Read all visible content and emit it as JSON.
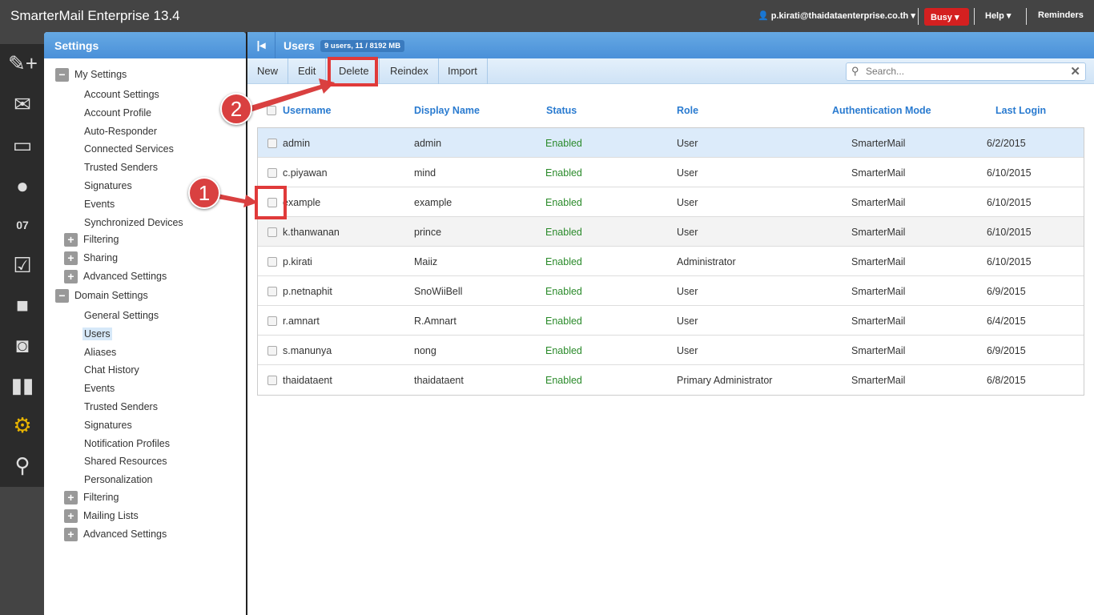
{
  "app_title": "SmarterMail Enterprise 13.4",
  "topbar": {
    "user": "p.kirati@thaidataenterprise.co.th",
    "status": "Busy",
    "help": "Help",
    "reminders": "Reminders"
  },
  "rail_icons": [
    "compose-icon",
    "mail-icon",
    "chat-icon",
    "contacts-icon",
    "calendar-icon",
    "tasks-icon",
    "notes-icon",
    "rss-icon",
    "reports-icon",
    "settings-icon",
    "search-icon"
  ],
  "calendar_day": "07",
  "sidebar": {
    "title": "Settings",
    "my_settings": {
      "label": "My Settings",
      "items": [
        "Account Settings",
        "Account Profile",
        "Auto-Responder",
        "Connected Services",
        "Trusted Senders",
        "Signatures",
        "Events",
        "Synchronized Devices"
      ],
      "groups": [
        "Filtering",
        "Sharing",
        "Advanced Settings"
      ]
    },
    "domain_settings": {
      "label": "Domain Settings",
      "items": [
        "General Settings",
        "Users",
        "Aliases",
        "Chat History",
        "Events",
        "Trusted Senders",
        "Signatures",
        "Notification Profiles",
        "Shared Resources",
        "Personalization"
      ],
      "groups": [
        "Filtering",
        "Mailing Lists",
        "Advanced Settings"
      ]
    }
  },
  "main": {
    "title": "Users",
    "badge": "9 users, 11 / 8192 MB",
    "toolbar": [
      "New",
      "Edit",
      "Delete",
      "Reindex",
      "Import"
    ],
    "search_placeholder": "Search...",
    "columns": [
      "Username",
      "Display Name",
      "Status",
      "Role",
      "Authentication Mode",
      "Last Login"
    ],
    "rows": [
      [
        "admin",
        "admin",
        "Enabled",
        "User",
        "SmarterMail",
        "6/2/2015"
      ],
      [
        "c.piyawan",
        "mind",
        "Enabled",
        "User",
        "SmarterMail",
        "6/10/2015"
      ],
      [
        "example",
        "example",
        "Enabled",
        "User",
        "SmarterMail",
        "6/10/2015"
      ],
      [
        "k.thanwanan",
        "prince",
        "Enabled",
        "User",
        "SmarterMail",
        "6/10/2015"
      ],
      [
        "p.kirati",
        "Maiiz",
        "Enabled",
        "Administrator",
        "SmarterMail",
        "6/10/2015"
      ],
      [
        "p.netnaphit",
        "SnoWiiBell",
        "Enabled",
        "User",
        "SmarterMail",
        "6/9/2015"
      ],
      [
        "r.amnart",
        "R.Amnart",
        "Enabled",
        "User",
        "SmarterMail",
        "6/4/2015"
      ],
      [
        "s.manunya",
        "nong",
        "Enabled",
        "User",
        "SmarterMail",
        "6/9/2015"
      ],
      [
        "thaidataent",
        "thaidataent",
        "Enabled",
        "Primary Administrator",
        "SmarterMail",
        "6/8/2015"
      ]
    ]
  },
  "annotations": [
    "1",
    "2"
  ]
}
